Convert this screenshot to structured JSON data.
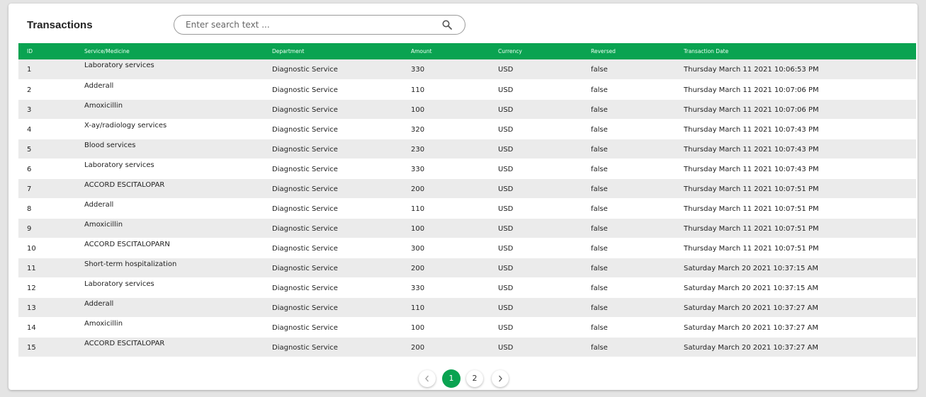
{
  "header": {
    "title": "Transactions",
    "search_placeholder": "Enter search text ..."
  },
  "table": {
    "columns": [
      "ID",
      "Service/Medicine",
      "Department",
      "Amount",
      "Currency",
      "Reversed",
      "Transaction Date"
    ],
    "rows": [
      [
        "1",
        "Laboratory services",
        "Diagnostic Service",
        "330",
        "USD",
        "false",
        "Thursday March 11 2021 10:06:53 PM"
      ],
      [
        "2",
        "Adderall",
        "Diagnostic Service",
        "110",
        "USD",
        "false",
        "Thursday March 11 2021 10:07:06 PM"
      ],
      [
        "3",
        "Amoxicillin",
        "Diagnostic Service",
        "100",
        "USD",
        "false",
        "Thursday March 11 2021 10:07:06 PM"
      ],
      [
        "4",
        "X-ay/radiology services",
        "Diagnostic Service",
        "320",
        "USD",
        "false",
        "Thursday March 11 2021 10:07:43 PM"
      ],
      [
        "5",
        "Blood services",
        "Diagnostic Service",
        "230",
        "USD",
        "false",
        "Thursday March 11 2021 10:07:43 PM"
      ],
      [
        "6",
        "Laboratory services",
        "Diagnostic Service",
        "330",
        "USD",
        "false",
        "Thursday March 11 2021 10:07:43 PM"
      ],
      [
        "7",
        "ACCORD ESCITALOPAR",
        "Diagnostic Service",
        "200",
        "USD",
        "false",
        "Thursday March 11 2021 10:07:51 PM"
      ],
      [
        "8",
        "Adderall",
        "Diagnostic Service",
        "110",
        "USD",
        "false",
        "Thursday March 11 2021 10:07:51 PM"
      ],
      [
        "9",
        "Amoxicillin",
        "Diagnostic Service",
        "100",
        "USD",
        "false",
        "Thursday March 11 2021 10:07:51 PM"
      ],
      [
        "10",
        "ACCORD ESCITALOPARN",
        "Diagnostic Service",
        "300",
        "USD",
        "false",
        "Thursday March 11 2021 10:07:51 PM"
      ],
      [
        "11",
        "Short-term hospitalization",
        "Diagnostic Service",
        "200",
        "USD",
        "false",
        "Saturday March 20 2021 10:37:15 AM"
      ],
      [
        "12",
        "Laboratory services",
        "Diagnostic Service",
        "330",
        "USD",
        "false",
        "Saturday March 20 2021 10:37:15 AM"
      ],
      [
        "13",
        "Adderall",
        "Diagnostic Service",
        "110",
        "USD",
        "false",
        "Saturday March 20 2021 10:37:27 AM"
      ],
      [
        "14",
        "Amoxicillin",
        "Diagnostic Service",
        "100",
        "USD",
        "false",
        "Saturday March 20 2021 10:37:27 AM"
      ],
      [
        "15",
        "ACCORD ESCITALOPAR",
        "Diagnostic Service",
        "200",
        "USD",
        "false",
        "Saturday March 20 2021 10:37:27 AM"
      ]
    ]
  },
  "pagination": {
    "pages": [
      "1",
      "2"
    ],
    "current_page": "1",
    "prev_icon": "chevron-left-icon",
    "next_icon": "chevron-right-icon"
  },
  "colors": {
    "accent": "#0aa351",
    "row_alt": "#ebebeb"
  }
}
